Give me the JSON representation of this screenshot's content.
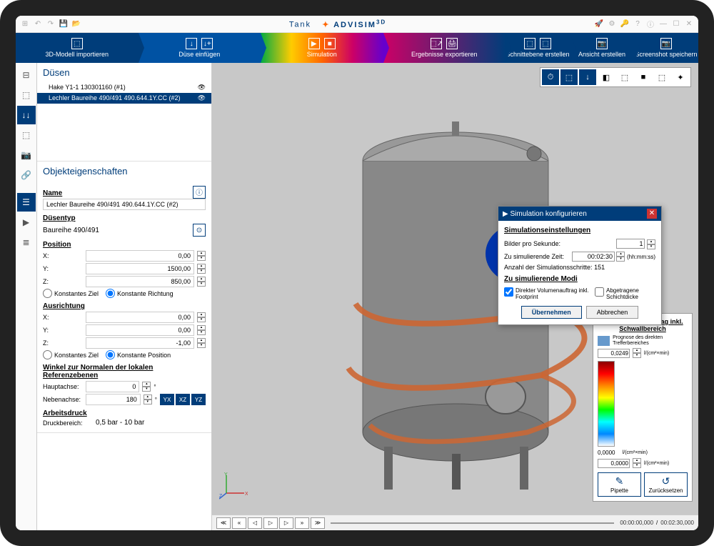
{
  "titlebar": {
    "doc_name": "Tank",
    "logo": "ADVISIM",
    "logo_suffix": "3D"
  },
  "workflow": {
    "import": "3D-Modell importieren",
    "nozzle": "Düse einfügen",
    "simulation": "Simulation",
    "export": "Ergebnisse exportieren",
    "cutplane": "Schnittebene erstellen",
    "view": "Ansicht erstellen",
    "screenshot": "Screenshot speichern"
  },
  "panel": {
    "nozzles_title": "Düsen",
    "nozzle_items": [
      "Hake Y1-1 130301160 (#1)",
      "Lechler Baureihe 490/491 490.644.1Y.CC (#2)"
    ],
    "props_title": "Objekteigenschaften",
    "name_label": "Name",
    "name_value": "Lechler Baureihe 490/491 490.644.1Y.CC (#2)",
    "type_label": "Düsentyp",
    "type_value": "Baureihe 490/491",
    "position_label": "Position",
    "position": {
      "x": "0,00",
      "y": "1500,00",
      "z": "850,00"
    },
    "pos_radio1": "Konstantes Ziel",
    "pos_radio2": "Konstante Richtung",
    "orientation_label": "Ausrichtung",
    "orientation": {
      "x": "0,00",
      "y": "0,00",
      "z": "-1,00"
    },
    "orient_radio1": "Konstantes Ziel",
    "orient_radio2": "Konstante Position",
    "angle_label": "Winkel zur Normalen der lokalen Referenzebenen",
    "main_axis": "Hauptachse:",
    "main_axis_val": "0",
    "sec_axis": "Nebenachse:",
    "sec_axis_val": "180",
    "axis_btns": [
      "YX",
      "XZ",
      "YZ"
    ],
    "pressure_label": "Arbeitsdruck",
    "pressure_range_label": "Druckbereich:",
    "pressure_range": "0,5 bar - 10 bar"
  },
  "dialog": {
    "title": "Simulation konfigurieren",
    "section1": "Simulationseinstellungen",
    "fps_label": "Bilder pro Sekunde:",
    "fps": "1",
    "time_label": "Zu simulierende Zeit:",
    "time": "00:02:30",
    "time_unit": "(hh:mm:ss)",
    "steps_label": "Anzahl der Simulationsschritte:",
    "steps_value": "151",
    "section2": "Zu simulierende Modi",
    "check1": "Direkter Volumenauftrag inkl. Footprint",
    "check2": "Abgetragene Schichtdicke",
    "ok": "Übernehmen",
    "cancel": "Abbrechen"
  },
  "legend": {
    "title": "Volumenstromauftrag inkl. Schwallbereich",
    "prognosis": "Prognose des direkten Trefferbereiches",
    "max_val": "0,0249",
    "unit": "l/(cm²×min)",
    "min_val": "0,0000",
    "min_unit": "l/(cm²×min)",
    "input_val": "0,0000",
    "pipette": "Pipette",
    "reset": "Zurücksetzen"
  },
  "playback": {
    "time_left": "00:00:00,000",
    "time_right": "00:02:30,000"
  }
}
